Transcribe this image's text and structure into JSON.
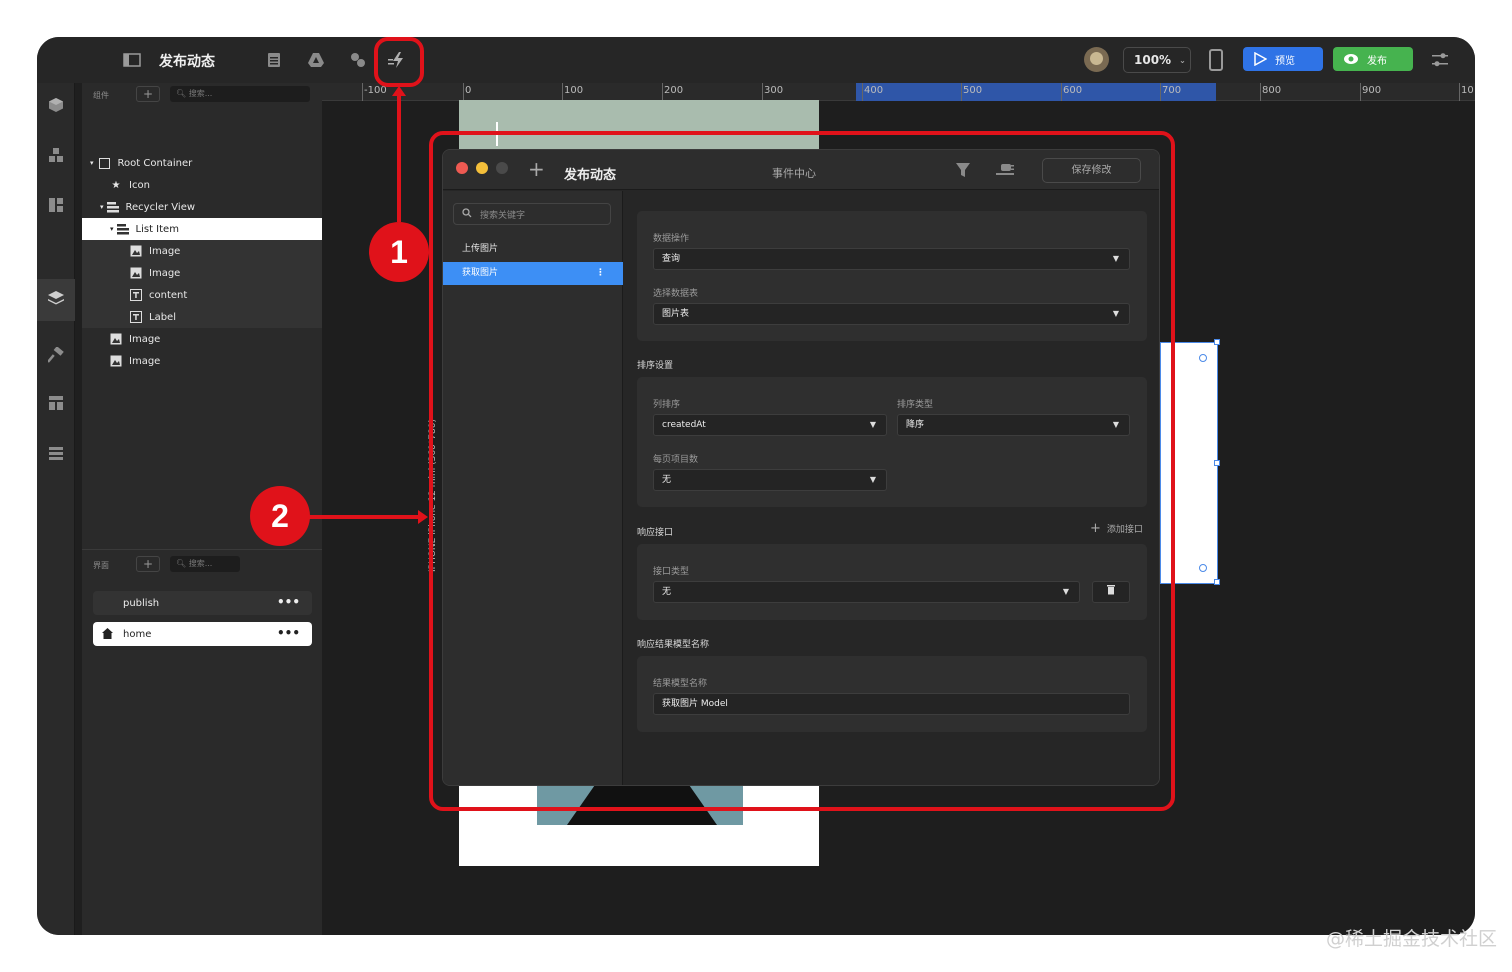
{
  "app": {
    "title": "发布动态",
    "zoom": "100%",
    "preview_label": "预览",
    "publish_label": "发布"
  },
  "ruler": {
    "labels": [
      "-100",
      "0",
      "100",
      "200",
      "300",
      "400",
      "500",
      "600",
      "700",
      "800",
      "900",
      "10"
    ]
  },
  "components_panel": {
    "header": "组件",
    "search_placeholder": "搜索...",
    "tree": [
      {
        "label": "Root Container",
        "icon": "square-icon"
      },
      {
        "label": "Icon",
        "icon": "star-icon"
      },
      {
        "label": "Recycler View",
        "icon": "stack-icon"
      },
      {
        "label": "List Item",
        "icon": "stack-icon"
      },
      {
        "label": "Image",
        "icon": "image-icon"
      },
      {
        "label": "Image",
        "icon": "image-icon"
      },
      {
        "label": "content",
        "icon": "text-icon"
      },
      {
        "label": "Label",
        "icon": "text-icon"
      },
      {
        "label": "Image",
        "icon": "image-icon"
      },
      {
        "label": "Image",
        "icon": "image-icon"
      }
    ]
  },
  "pages_panel": {
    "header": "界面",
    "search_placeholder": "搜索...",
    "pages": [
      {
        "label": "publish"
      },
      {
        "label": "home"
      }
    ]
  },
  "canvas": {
    "device_label": "IPHONE  iPhone 12 mini (360*780)"
  },
  "dialog": {
    "title": "发布动态",
    "center_title": "事件中心",
    "save_label": "保存修改",
    "search_placeholder": "搜索关键字",
    "events": [
      {
        "label": "上传图片"
      },
      {
        "label": "获取图片"
      }
    ],
    "data_op_label": "数据操作",
    "data_op_value": "查询",
    "table_label": "选择数据表",
    "table_value": "图片表",
    "sort_section": "排序设置",
    "sort_col_label": "列排序",
    "sort_col_value": "createdAt",
    "sort_type_label": "排序类型",
    "sort_type_value": "降序",
    "page_size_label": "每页项目数",
    "page_size_value": "无",
    "response_section": "响应接口",
    "add_api_label": "添加接口",
    "api_type_label": "接口类型",
    "api_type_value": "无",
    "result_section": "响应结果模型名称",
    "result_label": "结果模型名称",
    "result_value": "获取图片 Model"
  },
  "annotations": {
    "marker1": "1",
    "marker2": "2"
  },
  "watermark": "@稀土掘金技术社区",
  "colors": {
    "accent_blue": "#2f73e6",
    "publish_green": "#46b34f",
    "annotation_red": "#e0121a"
  }
}
